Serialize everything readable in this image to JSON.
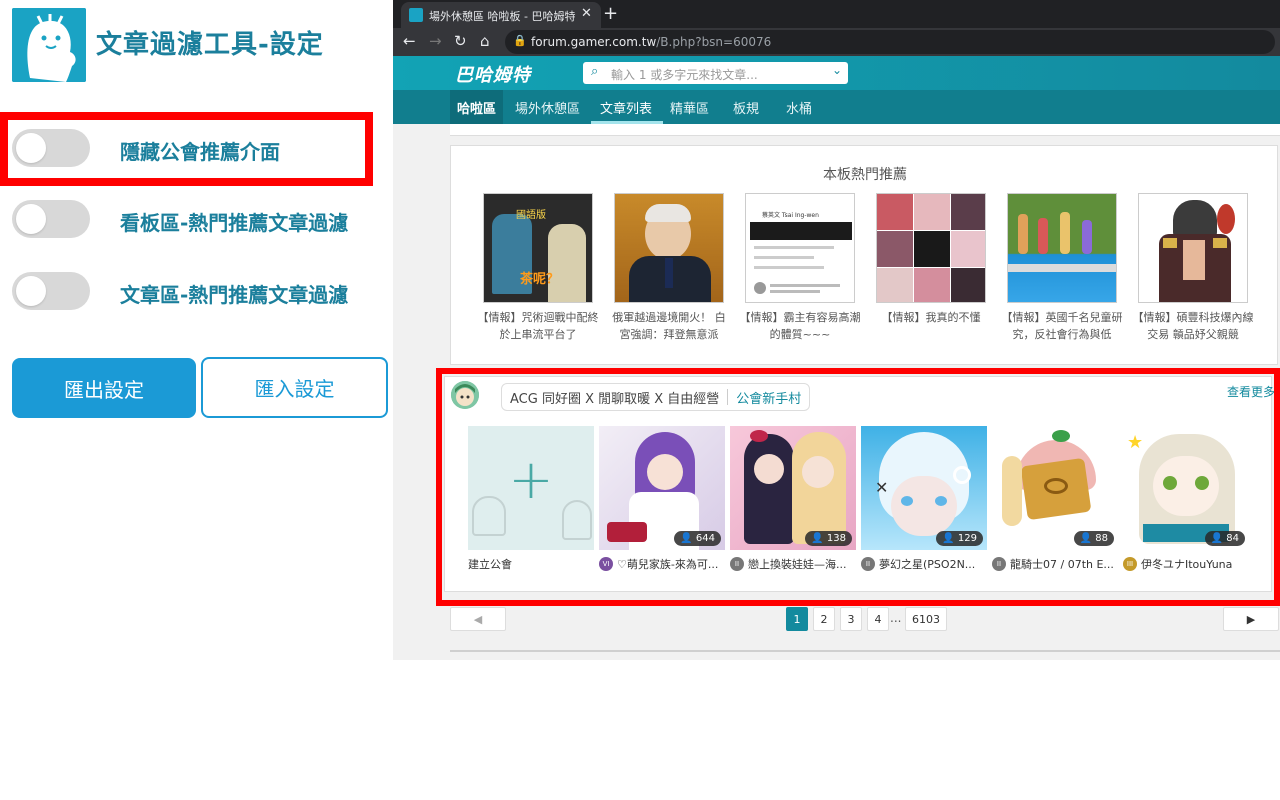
{
  "settings": {
    "title": "文章過濾工具-設定",
    "toggles": [
      {
        "label": "隱藏公會推薦介面",
        "on": false
      },
      {
        "label": "看板區-熱門推薦文章過濾",
        "on": false
      },
      {
        "label": "文章區-熱門推薦文章過濾",
        "on": false
      }
    ],
    "export_label": "匯出設定",
    "import_label": "匯入設定"
  },
  "browser": {
    "tab_title": "場外休憩區 哈啦板 - 巴哈姆特",
    "tab_close": "✕",
    "new_tab": "+",
    "url_host": "forum.gamer.com.tw",
    "url_path": "/B.php?bsn=60076"
  },
  "site": {
    "logo": "巴哈姆特",
    "search_placeholder": "輸入 1 或多字元來找文章...",
    "nav": [
      "哈啦區",
      "場外休憩區",
      "文章列表",
      "精華區",
      "板規",
      "水桶"
    ],
    "active_nav": "文章列表"
  },
  "hot": {
    "title": "本板熱門推薦",
    "items": [
      {
        "caption": "【情報】咒術迴戰中配終於上串流平台了",
        "thumb_text": "國語版",
        "thumb_text2": "茶呢？"
      },
      {
        "caption": "俄軍越過邊境開火！ 白宮強調：拜登無意派"
      },
      {
        "caption": "【情報】霸主有容易高潮的體質~~~",
        "thumb_text": "蔡英文 Tsai Ing-wen"
      },
      {
        "caption": "【情報】我真的不懂"
      },
      {
        "caption": "【情報】英國千名兒童研究，反社會行為與低"
      },
      {
        "caption": "【情報】碩豐科技爆內線交易 贑品妤父親競"
      }
    ]
  },
  "guild": {
    "intro_a": "ACG 同好圈 X 閒聊取暖 X 自由經營",
    "intro_link": "公會新手村",
    "more": "查看更多",
    "create_label": "建立公會",
    "cards": [
      {
        "name": "♡萌兒家族-來為可...",
        "count": "644",
        "level": "VI",
        "badge_color": "#7a4fa0"
      },
      {
        "name": "戀上換裝娃娃—海...",
        "count": "138",
        "level": "II",
        "badge_color": "#777777"
      },
      {
        "name": "夢幻之星(PSO2N...",
        "count": "129",
        "level": "II",
        "badge_color": "#777777"
      },
      {
        "name": "龍騎士07 / 07th E...",
        "count": "88",
        "level": "II",
        "badge_color": "#777777"
      },
      {
        "name": "伊冬ユナItouYuna",
        "count": "84",
        "level": "III",
        "badge_color": "#c49a2a"
      }
    ]
  },
  "pager": {
    "prev": "◀",
    "next": "▶",
    "pages": [
      "1",
      "2",
      "3",
      "4"
    ],
    "dots": "...",
    "last": "6103",
    "current": "1"
  },
  "icons": {
    "back": "←",
    "forward": "→",
    "reload": "↻",
    "home": "⌂",
    "lock": "🔒",
    "search": "⌕",
    "chevron": "⌄",
    "plus": "+",
    "user": "👤"
  },
  "colors": {
    "accent": "#1b7f9c",
    "button": "#1b9ad6",
    "site_teal": "#138a9e",
    "highlight": "#ff0000"
  }
}
